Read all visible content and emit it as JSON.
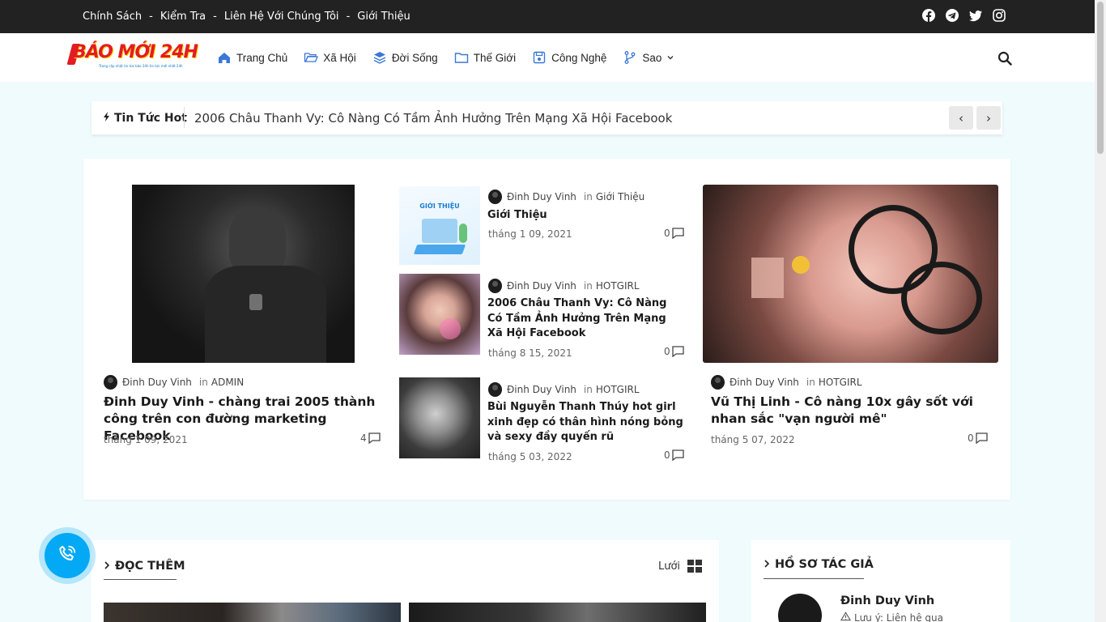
{
  "topbar": {
    "links": [
      "Chính Sách",
      "Kiểm Tra",
      "Liên Hệ Với Chúng Tôi",
      "Giới Thiệu"
    ],
    "separator": "-",
    "social": [
      "facebook-icon",
      "telegram-icon",
      "twitter-icon",
      "instagram-icon"
    ]
  },
  "header": {
    "logo_text": "BÁO MỚI 24H",
    "logo_tagline": "Trang cập nhật tin tức báo 24h tin tức mới nhất 24h",
    "nav": [
      {
        "label": "Trang Chủ",
        "icon": "home-icon"
      },
      {
        "label": "Xã Hội",
        "icon": "folder-open-icon"
      },
      {
        "label": "Đời Sống",
        "icon": "layers-icon"
      },
      {
        "label": "Thế Giới",
        "icon": "folder-icon"
      },
      {
        "label": "Công Nghệ",
        "icon": "save-icon"
      },
      {
        "label": "Sao",
        "icon": "branch-icon"
      }
    ]
  },
  "ticker": {
    "label": "Tin Tức Hot",
    "headline": "2006 Châu Thanh Vy: Cô Nàng Có Tầm Ảnh Hưởng Trên Mạng Xã Hội Facebook",
    "prev": "‹",
    "next": "›"
  },
  "featured": {
    "left": {
      "author": "Đinh Duy Vinh",
      "in": "in",
      "category": "ADMIN",
      "title": "Đinh Duy Vinh - chàng trai 2005 thành công trên con đường marketing Facebook",
      "date": "tháng 1 09, 2021",
      "comments": "4"
    },
    "middle": [
      {
        "author": "Đinh Duy Vinh",
        "in": "in",
        "category": "Giới Thiệu",
        "title": "Giới Thiệu",
        "date": "tháng 1 09, 2021",
        "comments": "0",
        "thumb_text": "GIỚI THIỆU"
      },
      {
        "author": "Đinh Duy Vinh",
        "in": "in",
        "category": "HOTGIRL",
        "title": "2006 Châu Thanh Vy: Cô Nàng Có Tầm Ảnh Hưởng Trên Mạng Xã Hội Facebook",
        "date": "tháng 8 15, 2021",
        "comments": "0"
      },
      {
        "author": "Đinh Duy Vinh",
        "in": "in",
        "category": "HOTGIRL",
        "title": "Bùi Nguyễn Thanh Thúy hot girl xinh đẹp có thân hình nóng bỏng và sexy đầy quyến rũ",
        "date": "tháng 5 03, 2022",
        "comments": "0"
      }
    ],
    "right": {
      "author": "Đinh Duy Vinh",
      "in": "in",
      "category": "HOTGIRL",
      "title": "Vũ Thị Linh - Cô nàng 10x gây sốt với nhan sắc \"vạn người mê\"",
      "date": "tháng 5 07, 2022",
      "comments": "0"
    }
  },
  "docthem": {
    "title": "ĐỌC THÊM",
    "view_label": "Lưới"
  },
  "profile": {
    "title": "HỒ SƠ TÁC GIẢ",
    "name": "Đinh Duy Vinh",
    "note": "Lưu ý: Liên hệ qua"
  },
  "colors": {
    "accent": "#03a9f4",
    "topbar": "#222222",
    "page_bg": "#f0fbfd"
  }
}
